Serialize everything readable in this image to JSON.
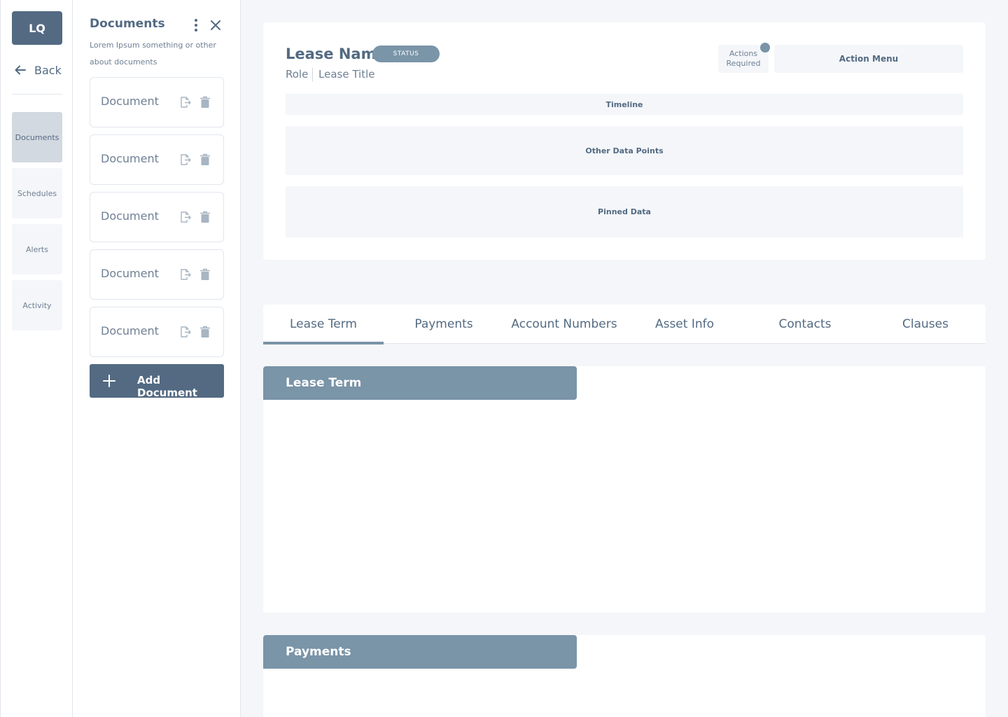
{
  "rail": {
    "logo": "LQ",
    "back_label": "Back",
    "items": [
      {
        "label": "Documents",
        "active": true
      },
      {
        "label": "Schedules",
        "active": false
      },
      {
        "label": "Alerts",
        "active": false
      },
      {
        "label": "Activity",
        "active": false
      }
    ]
  },
  "documents_panel": {
    "title": "Documents",
    "description": "Lorem Ipsum something or other about documents",
    "documents": [
      {
        "label": "Document"
      },
      {
        "label": "Document"
      },
      {
        "label": "Document"
      },
      {
        "label": "Document"
      },
      {
        "label": "Document"
      }
    ],
    "add_label": "Add Document"
  },
  "lease": {
    "name": "Lease Name",
    "status": "STATUS",
    "role": "Role",
    "title": "Lease Title",
    "actions_required": "Actions Required",
    "action_menu": "Action Menu",
    "timeline": "Timeline",
    "other_data_points": "Other Data Points",
    "pinned_data": "Pinned Data"
  },
  "tabs": [
    {
      "label": "Lease Term",
      "active": true
    },
    {
      "label": "Payments",
      "active": false
    },
    {
      "label": "Account Numbers",
      "active": false
    },
    {
      "label": "Asset Info",
      "active": false
    },
    {
      "label": "Contacts",
      "active": false
    },
    {
      "label": "Clauses",
      "active": false
    }
  ],
  "sections": [
    {
      "title": "Lease Term"
    },
    {
      "title": "Payments"
    }
  ],
  "colors": {
    "primary": "#536a82",
    "accent": "#7a94a8",
    "surface": "#f4f6f9",
    "rail_active": "#d3d9e0"
  }
}
